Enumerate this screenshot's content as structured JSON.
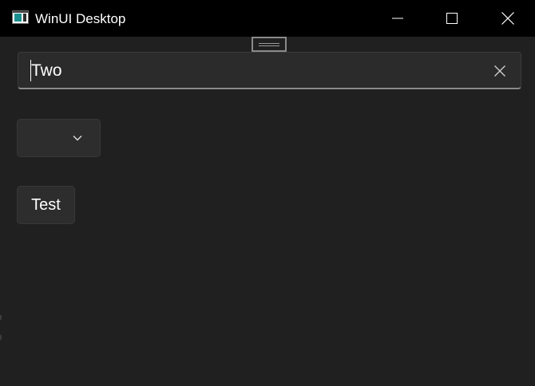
{
  "window": {
    "title": "WinUI Desktop",
    "icon": "app-window-icon"
  },
  "caption_buttons": {
    "minimize_icon": "minimize-icon",
    "maximize_icon": "maximize-icon",
    "close_icon": "close-icon"
  },
  "drag_handle": {
    "icon": "drag-handle-icon"
  },
  "textbox": {
    "value": "Two",
    "clear_icon": "clear-x-icon",
    "focused": true
  },
  "combobox": {
    "selected_value": "",
    "chevron_icon": "chevron-down-icon"
  },
  "test_button": {
    "label": "Test"
  },
  "colors": {
    "background": "#202020",
    "titlebar": "#000000",
    "control": "#2d2d2d",
    "text": "#ffffff",
    "accent_underline": "#8a8a8a"
  }
}
